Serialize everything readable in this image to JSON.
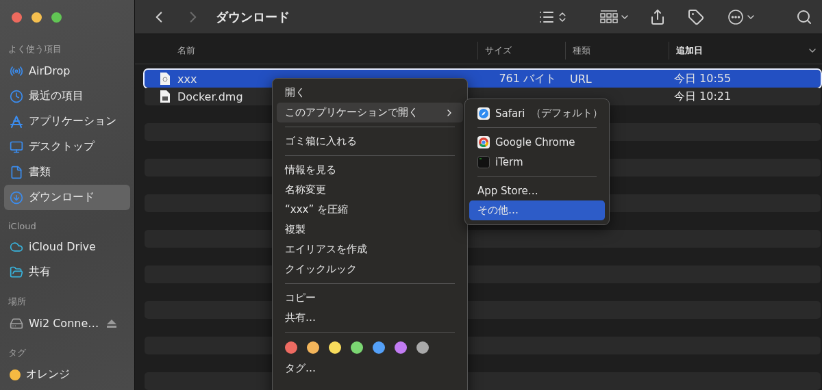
{
  "window": {
    "title": "ダウンロード"
  },
  "sidebar": {
    "sections": [
      {
        "header": "よく使う項目",
        "items": [
          {
            "label": "AirDrop",
            "selected": false
          },
          {
            "label": "最近の項目",
            "selected": false
          },
          {
            "label": "アプリケーション",
            "selected": false
          },
          {
            "label": "デスクトップ",
            "selected": false
          },
          {
            "label": "書類",
            "selected": false
          },
          {
            "label": "ダウンロード",
            "selected": true
          }
        ]
      },
      {
        "header": "iCloud",
        "items": [
          {
            "label": "iCloud Drive",
            "selected": false
          },
          {
            "label": "共有",
            "selected": false
          }
        ]
      },
      {
        "header": "場所",
        "items": [
          {
            "label": "Wi2 Conne…",
            "selected": false,
            "eject": true
          }
        ]
      },
      {
        "header": "タグ",
        "items": [
          {
            "label": "オレンジ",
            "selected": false,
            "color": "#f5b942"
          }
        ]
      }
    ]
  },
  "table": {
    "columns": [
      {
        "label": "名前",
        "sorted": false
      },
      {
        "label": "サイズ",
        "sorted": false
      },
      {
        "label": "種類",
        "sorted": false
      },
      {
        "label": "追加日",
        "sorted": true
      }
    ],
    "rows": [
      {
        "name": "xxx",
        "size": "761 バイト",
        "kind": "URL",
        "added": "今日 10:55",
        "selected": true
      },
      {
        "name": "Docker.dmg",
        "added": "今日 10:21",
        "selected": false
      }
    ]
  },
  "context_menu": {
    "items": [
      {
        "kind": "item",
        "label": "開く",
        "selected": false
      },
      {
        "kind": "submenu",
        "label": "このアプリケーションで開く",
        "selected": true
      },
      {
        "kind": "separator"
      },
      {
        "kind": "item",
        "label": "ゴミ箱に入れる",
        "selected": false
      },
      {
        "kind": "separator"
      },
      {
        "kind": "item",
        "label": "情報を見る",
        "selected": false
      },
      {
        "kind": "item",
        "label": "名称変更",
        "selected": false
      },
      {
        "kind": "item",
        "label": "“xxx” を圧縮",
        "selected": false
      },
      {
        "kind": "item",
        "label": "複製",
        "selected": false
      },
      {
        "kind": "item",
        "label": "エイリアスを作成",
        "selected": false
      },
      {
        "kind": "item",
        "label": "クイックルック",
        "selected": false
      },
      {
        "kind": "separator"
      },
      {
        "kind": "item",
        "label": "コピー",
        "selected": false
      },
      {
        "kind": "item",
        "label": "共有…",
        "selected": false
      },
      {
        "kind": "separator"
      },
      {
        "kind": "tags",
        "tags": [
          {
            "color": "#ee6b62"
          },
          {
            "color": "#f3b55b"
          },
          {
            "color": "#f8dc5c"
          },
          {
            "color": "#7bd672"
          },
          {
            "color": "#54a0f8"
          },
          {
            "color": "#c27cf3"
          },
          {
            "color": "#a9a9a9"
          }
        ]
      },
      {
        "kind": "item",
        "label": "タグ…",
        "selected": false
      }
    ]
  },
  "submenu": {
    "items": [
      {
        "kind": "app",
        "label": "Safari",
        "note": "（デフォルト）",
        "selected": false
      },
      {
        "kind": "separator"
      },
      {
        "kind": "app",
        "label": "Google Chrome",
        "selected": false
      },
      {
        "kind": "app",
        "label": "iTerm",
        "selected": false
      },
      {
        "kind": "separator"
      },
      {
        "kind": "item",
        "label": "App Store…",
        "selected": false
      },
      {
        "kind": "item",
        "label": "その他…",
        "selected": true
      }
    ]
  }
}
